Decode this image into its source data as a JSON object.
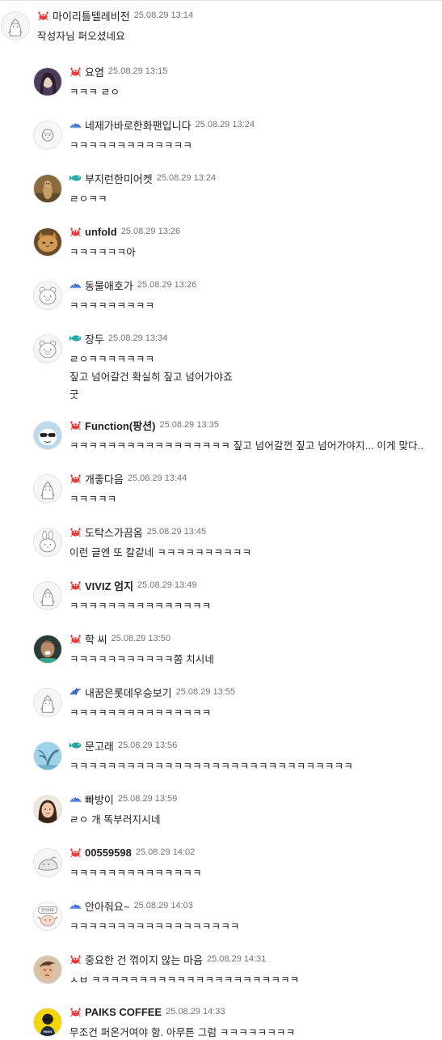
{
  "comments": [
    {
      "nickname": "마이리틀텔레비전",
      "time": "25.08.29 13:14",
      "lines": [
        "작성자님 퍼오셨네요"
      ],
      "badge": "red-crab-icon",
      "avatar": "penguin"
    },
    {
      "nickname": "요염",
      "time": "25.08.29 13:15",
      "lines": [
        "ㅋㅋㅋ ㄹㅇ"
      ],
      "badge": "red-crab-icon",
      "avatar": "photo-woman"
    },
    {
      "nickname": "네제가바로한화팬입니다",
      "time": "25.08.29 13:24",
      "lines": [
        "ㅋㅋㅋㅋㅋㅋㅋㅋㅋㅋㅋㅋㅋ"
      ],
      "badge": "blue-fish-icon",
      "avatar": "penguin-b"
    },
    {
      "nickname": "부지런한미어켓",
      "time": "25.08.29 13:24",
      "lines": [
        "ㄹㅇㅋㅋ"
      ],
      "badge": "teal-fish-icon",
      "avatar": "photo-meerkat"
    },
    {
      "nickname": "unfold",
      "time": "25.08.29 13:26",
      "lines": [
        "ㅋㅋㅋㅋㅋㅋ아"
      ],
      "badge": "red-crab-icon",
      "avatar": "photo-cat"
    },
    {
      "nickname": "동물애호가",
      "time": "25.08.29 13:26",
      "lines": [
        "ㅋㅋㅋㅋㅋㅋㅋㅋㅋ"
      ],
      "badge": "blue-fish-icon",
      "avatar": "bear"
    },
    {
      "nickname": "장두",
      "time": "25.08.29 13:34",
      "lines": [
        "ㄹㅇㅋㅋㅋㅋㅋㅋㅋ",
        "짚고 넘어갈건 확실히 짚고 넘어가야죠",
        "굿"
      ],
      "badge": "teal-fish-icon",
      "avatar": "bear"
    },
    {
      "nickname": "Function(팡션)",
      "time": "25.08.29 13:35",
      "lines": [
        "ㅋㅋㅋㅋㅋㅋㅋㅋㅋㅋㅋㅋㅋㅋㅋㅋㅋ 짚고 넘어갈껀 짚고 넘어가야지... 이게 맞다.."
      ],
      "badge": "red-crab-icon",
      "avatar": "sunglasses"
    },
    {
      "nickname": "개좋다음",
      "time": "25.08.29 13:44",
      "lines": [
        "ㅋㅋㅋㅋㅋ"
      ],
      "badge": "red-crab-icon",
      "avatar": "penguin"
    },
    {
      "nickname": "도탁스가끔옴",
      "time": "25.08.29 13:45",
      "lines": [
        "이런 글엔 또 칼같네 ㅋㅋㅋㅋㅋㅋㅋㅋㅋㅋ"
      ],
      "badge": "red-crab-icon",
      "avatar": "rabbit"
    },
    {
      "nickname": "VIVIZ 엄지",
      "time": "25.08.29 13:49",
      "lines": [
        "ㅋㅋㅋㅋㅋㅋㅋㅋㅋㅋㅋㅋㅋㅋㅋ"
      ],
      "badge": "red-crab-icon",
      "avatar": "penguin"
    },
    {
      "nickname": "학 씨",
      "time": "25.08.29 13:50",
      "lines": [
        "ㅋㅋㅋㅋㅋㅋㅋㅋㅋㅋㅋ쫌 치시네"
      ],
      "badge": "red-crab-icon",
      "avatar": "photo-man"
    },
    {
      "nickname": "내꿈은롯데우승보기",
      "time": "25.08.29 13:55",
      "lines": [
        "ㅋㅋㅋㅋㅋㅋㅋㅋㅋㅋㅋㅋㅋㅋㅋ"
      ],
      "badge": "blue-dolphin-icon",
      "avatar": "penguin"
    },
    {
      "nickname": "문고래",
      "time": "25.08.29 13:56",
      "lines": [
        "ㅋㅋㅋㅋㅋㅋㅋㅋㅋㅋㅋㅋㅋㅋㅋㅋㅋㅋㅋㅋㅋㅋㅋㅋㅋㅋㅋㅋㅋㅋ"
      ],
      "badge": "teal-fish-icon",
      "avatar": "whale-tail"
    },
    {
      "nickname": "빠방이",
      "time": "25.08.29 13:59",
      "lines": [
        "ㄹㅇ 개 똑부러지시네"
      ],
      "badge": "blue-fish-icon",
      "avatar": "photo-girl"
    },
    {
      "nickname": "00559598",
      "time": "25.08.29 14:02",
      "lines": [
        "ㅋㅋㅋㅋㅋㅋㅋㅋㅋㅋㅋㅋㅋㅋ"
      ],
      "badge": "red-crab-icon",
      "avatar": "seal"
    },
    {
      "nickname": "안아줘요~",
      "time": "25.08.29 14:03",
      "lines": [
        "ㅋㅋㅋㅋㅋㅋㅋㅋㅋㅋㅋㅋㅋㅋㅋㅋㅋㅋ"
      ],
      "badge": "blue-fish-icon",
      "avatar": "hug"
    },
    {
      "nickname": "중요한 건 꺾이지 않는 마음",
      "time": "25.08.29 14:31",
      "lines": [
        "ㅅㅂ ㅋㅋㅋㅋㅋㅋㅋㅋㅋㅋㅋㅋㅋㅋㅋㅋㅋㅋㅋㅋㅋㅋ"
      ],
      "badge": "red-crab-icon",
      "avatar": "photo-anime"
    },
    {
      "nickname": "PAIKS COFFEE",
      "time": "25.08.29 14:33",
      "lines": [
        "무조건 퍼온거여야 함. 아무튼 그럼 ㅋㅋㅋㅋㅋㅋㅋㅋ"
      ],
      "badge": "red-crab-icon",
      "avatar": "paiks"
    }
  ],
  "paiks_logo_text": "PAIKS",
  "hug_sign_text": "안아줘요",
  "colors": {
    "nickname": "#222222",
    "time": "#757575",
    "text": "#222222",
    "crab": "#e2413b",
    "blue_fish": "#3d6bd0",
    "teal_fish": "#27a7a5",
    "paiks_yellow": "#f4d600"
  }
}
